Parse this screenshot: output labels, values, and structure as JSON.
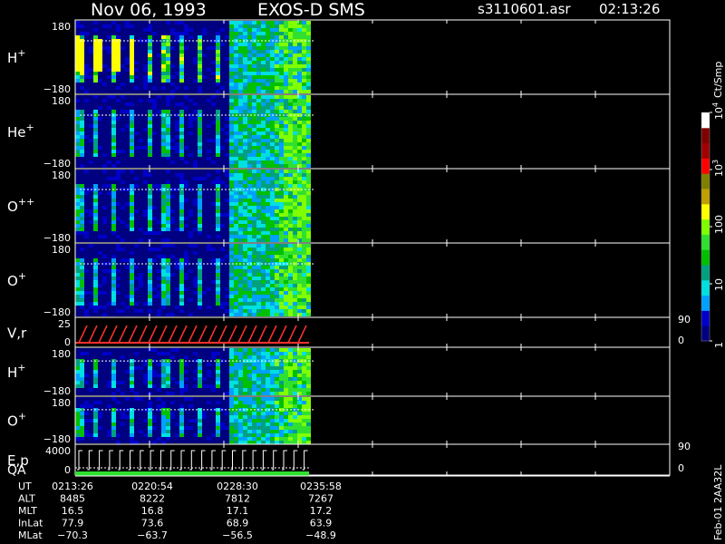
{
  "header": {
    "date": "Nov 06, 1993",
    "instrument": "EXOS-D SMS",
    "file": "s3110601.asr",
    "time": "02:13:26"
  },
  "chart_data": {
    "type": "heatmap",
    "panels": [
      {
        "id": "h-plus",
        "label": "H",
        "sup": "+",
        "ymax": "180",
        "ymin": "−180",
        "ylim": [
          -180,
          180
        ]
      },
      {
        "id": "he-plus",
        "label": "He",
        "sup": "+",
        "ymax": "180",
        "ymin": "−180",
        "ylim": [
          -180,
          180
        ]
      },
      {
        "id": "o-plusplus",
        "label": "O",
        "sup": "++",
        "ymax": "180",
        "ymin": "−180",
        "ylim": [
          -180,
          180
        ]
      },
      {
        "id": "o-plus",
        "label": "O",
        "sup": "+",
        "ymax": "180",
        "ymin": "−180",
        "ylim": [
          -180,
          180
        ]
      },
      {
        "id": "v-r",
        "label": "V,r",
        "ymax": "25",
        "ymin": "0",
        "right_max": "90",
        "right_min": "0"
      },
      {
        "id": "h-plus-2",
        "label": "H",
        "sup": "+",
        "ymax": "180",
        "ymin": "−180",
        "ylim": [
          -180,
          180
        ]
      },
      {
        "id": "o-plus-2",
        "label": "O",
        "sup": "+",
        "ymax": "180",
        "ymin": "−180",
        "ylim": [
          -180,
          180
        ]
      },
      {
        "id": "e-p",
        "label": "E,p",
        "ymax": "4000",
        "ymin": "0",
        "right_max": "90",
        "right_min": "0"
      }
    ],
    "qa_label": "QA",
    "colorbar": {
      "unit": "Ct/Smp",
      "ticks": [
        {
          "base": "10",
          "exp": "4",
          "value": 10000
        },
        {
          "base": "10",
          "exp": "3",
          "value": 1000
        },
        {
          "base": "100",
          "exp": "",
          "value": 100
        },
        {
          "base": "10",
          "exp": "",
          "value": 10
        },
        {
          "base": "1",
          "exp": "",
          "value": 1
        }
      ],
      "scale": "log",
      "colors": [
        "#000080",
        "#0000c8",
        "#00a0ff",
        "#00e0e0",
        "#00a080",
        "#00c000",
        "#30e030",
        "#80ff00",
        "#ffff00",
        "#c0a000",
        "#808000",
        "#ff0000",
        "#a00000",
        "#800000",
        "#ffffff"
      ]
    },
    "x_ticks": [
      "0213:26",
      "0220:54",
      "0228:30",
      "0235:58"
    ],
    "data_end_time": "0235:58"
  },
  "ephemeris": {
    "rows": [
      {
        "label": "UT",
        "values": [
          "0213:26",
          "0220:54",
          "0228:30",
          "0235:58"
        ]
      },
      {
        "label": "ALT",
        "values": [
          "8485",
          "8222",
          "7812",
          "7267"
        ]
      },
      {
        "label": "MLT",
        "values": [
          "16.5",
          "16.8",
          "17.1",
          "17.2"
        ]
      },
      {
        "label": "InLat",
        "values": [
          "77.9",
          "73.6",
          "68.9",
          "63.9"
        ]
      },
      {
        "label": "MLat",
        "values": [
          "−70.3",
          "−63.7",
          "−56.5",
          "−48.9"
        ]
      }
    ]
  },
  "footer_id": "Feb-01 2AA32L"
}
